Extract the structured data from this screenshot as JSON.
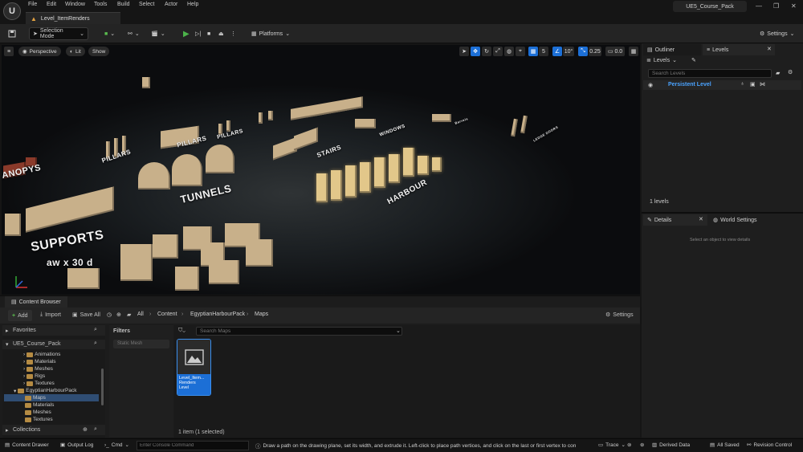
{
  "app": {
    "logo_letter": "U",
    "menu": [
      "File",
      "Edit",
      "Window",
      "Tools",
      "Build",
      "Select",
      "Actor",
      "Help"
    ],
    "level_tab": "Level_ItemRenders",
    "project_name": "UE5_Course_Pack",
    "window_controls": [
      "—",
      "❐",
      "✕"
    ]
  },
  "toolbar": {
    "selection_mode": "Selection Mode",
    "platforms": "Platforms",
    "settings": "Settings"
  },
  "viewport": {
    "perspective": "Perspective",
    "lit": "Lit",
    "show": "Show",
    "grid_value": "5",
    "angle_value": "10°",
    "scale_value": "0.25",
    "camera_speed": "0.0",
    "scene_labels": {
      "canopys": "ANOPYS",
      "pillars_1": "PILLARS",
      "pillars_2": "PILLARS",
      "pillars_3": "PILLARS",
      "tunnels": "TUNNELS",
      "stairs": "STAIRS",
      "windows": "WINDOWS",
      "harbour": "HARBOUR",
      "supports": "SUPPORTS",
      "overlay": "aw x 30 d",
      "misc": "Barrels",
      "far": "LEDGE DOORS"
    }
  },
  "outliner": {
    "tab_outliner": "Outliner",
    "tab_levels": "Levels",
    "levels_dropdown": "Levels",
    "search_placeholder": "Search Levels",
    "persistent_level": "Persistent Level",
    "count": "1 levels"
  },
  "details": {
    "tab_details": "Details",
    "tab_world_settings": "World Settings",
    "empty_hint": "Select an object to view details"
  },
  "content_browser": {
    "tab": "Content Browser",
    "add": "Add",
    "import": "Import",
    "save_all": "Save All",
    "breadcrumb": [
      "All",
      "Content",
      "EgyptianHarbourPack",
      "Maps"
    ],
    "settings": "Settings",
    "favorites": "Favorites",
    "project_root": "UE5_Course_Pack",
    "tree": [
      {
        "label": "Animations",
        "depth": 2
      },
      {
        "label": "Materials",
        "depth": 2
      },
      {
        "label": "Meshes",
        "depth": 2
      },
      {
        "label": "Rigs",
        "depth": 2
      },
      {
        "label": "Textures",
        "depth": 2
      },
      {
        "label": "EgyptianHarbourPack",
        "depth": 1
      },
      {
        "label": "Maps",
        "depth": 2,
        "selected": true
      },
      {
        "label": "Materials",
        "depth": 2
      },
      {
        "label": "Meshes",
        "depth": 2
      },
      {
        "label": "Textures",
        "depth": 2
      }
    ],
    "collections": "Collections",
    "filters_label": "Filters",
    "filter_chip": "Static Mesh",
    "search_placeholder": "Search Maps",
    "asset_name": "Level_Item... Renders",
    "asset_type": "Level",
    "item_count": "1 item (1 selected)"
  },
  "statusbar": {
    "content_drawer": "Content Drawer",
    "output_log": "Output Log",
    "cmd": "Cmd",
    "console_placeholder": "Enter Console Command",
    "hint": "Draw a path on the drawing plane, set its width, and extrude it. Left-click to place path vertices, and click on the last or first vertex to con",
    "trace": "Trace",
    "derived_data": "Derived Data",
    "all_saved": "All Saved",
    "revision_control": "Revision Control"
  },
  "colors": {
    "accent_blue": "#1c6fd6",
    "play_green": "#4cb34a",
    "folder_orange": "#b58b43",
    "persistent_level_blue": "#4aa3ff"
  }
}
